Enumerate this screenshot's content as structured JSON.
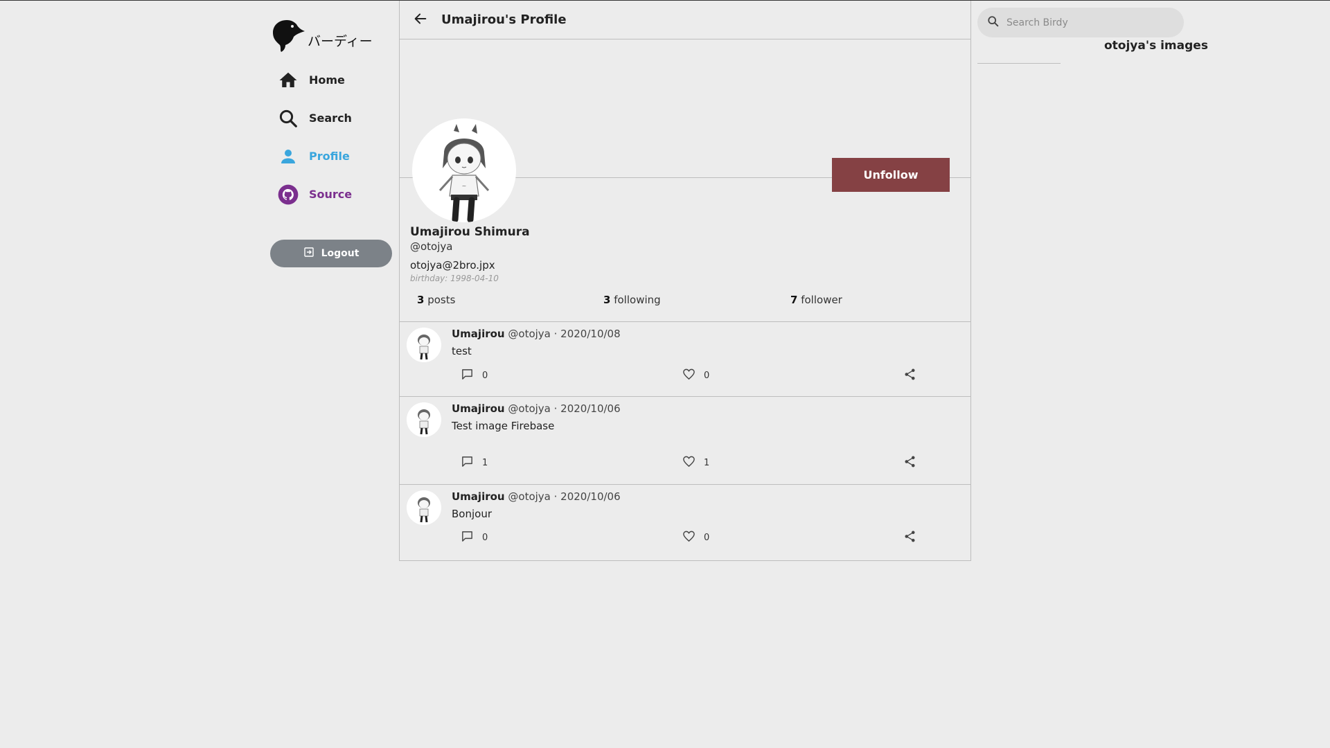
{
  "brand": {
    "name": "バーディー",
    "logo_icon": "crow-head-icon"
  },
  "nav": {
    "items": [
      {
        "label": "Home",
        "icon": "home-icon"
      },
      {
        "label": "Search",
        "icon": "search-icon"
      },
      {
        "label": "Profile",
        "icon": "person-icon",
        "active": true
      },
      {
        "label": "Source",
        "icon": "github-icon"
      }
    ],
    "logout_label": "Logout"
  },
  "header": {
    "title": "Umajirou's Profile"
  },
  "profile": {
    "display_name": "Umajirou Shimura",
    "handle": "@otojya",
    "email": "otojya@2bro.jpx",
    "birthday": "birthday: 1998-04-10",
    "unfollow_label": "Unfollow",
    "stats": {
      "posts_count": "3",
      "posts_label": "posts",
      "following_count": "3",
      "following_label": "following",
      "follower_count": "7",
      "follower_label": "follower"
    }
  },
  "posts": [
    {
      "name": "Umajirou",
      "meta": "@otojya · 2020/10/08",
      "text": "test",
      "comments": "0",
      "likes": "0"
    },
    {
      "name": "Umajirou",
      "meta": "@otojya · 2020/10/06",
      "text": "Test image Firebase",
      "comments": "1",
      "likes": "1"
    },
    {
      "name": "Umajirou",
      "meta": "@otojya · 2020/10/06",
      "text": "Bonjour",
      "comments": "0",
      "likes": "0"
    }
  ],
  "right": {
    "search_placeholder": "Search Birdy",
    "images_title": "otojya's images"
  },
  "colors": {
    "accent": "#3aa6dd",
    "source": "#7b2f8e",
    "unfollow": "#854144",
    "logout": "#7c8288"
  }
}
